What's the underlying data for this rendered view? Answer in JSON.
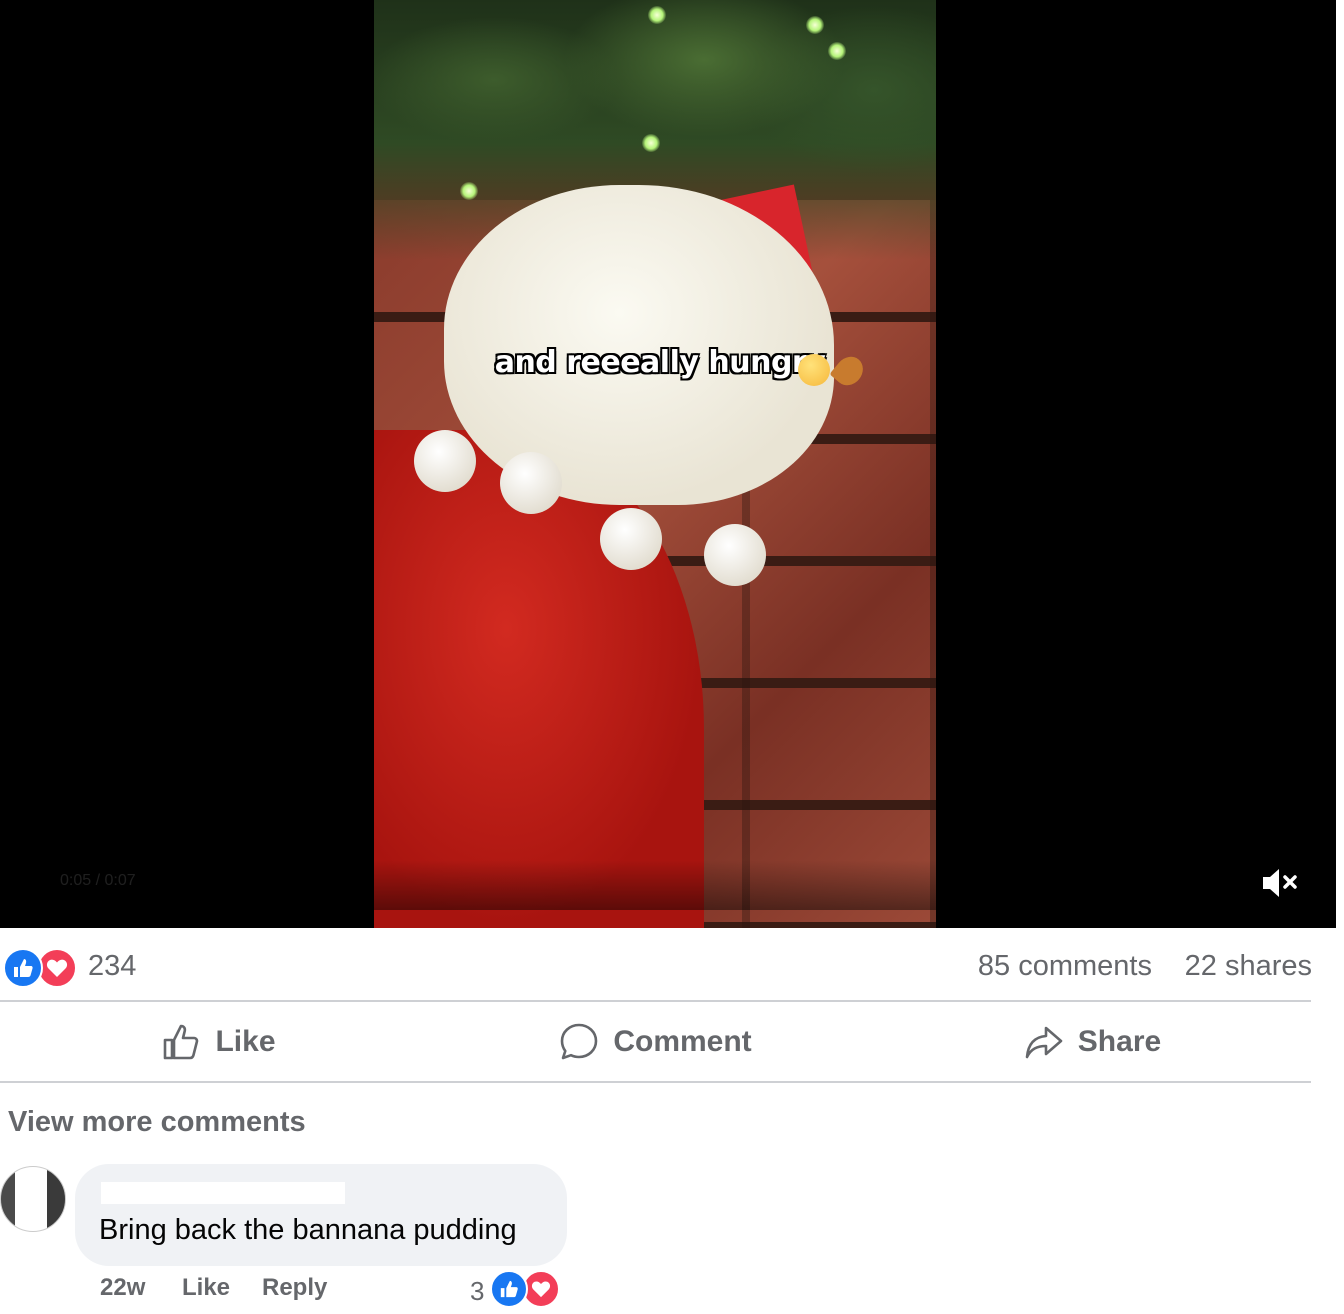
{
  "video": {
    "caption": "and reeeally hungry",
    "caption_emojis": [
      "face-savoring-food",
      "poultry-leg"
    ],
    "time_display": "0:05 / 0:07",
    "muted": true
  },
  "summary": {
    "reaction_count": "234",
    "reactions": [
      "like",
      "love"
    ],
    "comments_count": "85 comments",
    "shares_count": "22 shares"
  },
  "actions": {
    "like_label": "Like",
    "comment_label": "Comment",
    "share_label": "Share"
  },
  "comments": {
    "view_more_label": "View more comments",
    "items": [
      {
        "text": "Bring back the bannana pudding",
        "time": "22w",
        "like_label": "Like",
        "reply_label": "Reply",
        "reaction_count": "3",
        "reactions": [
          "like",
          "love"
        ]
      }
    ]
  },
  "colors": {
    "like_blue": "#1877f2",
    "love_red": "#f33e58",
    "secondary_text": "#65676b",
    "bubble_bg": "#f0f2f5"
  }
}
